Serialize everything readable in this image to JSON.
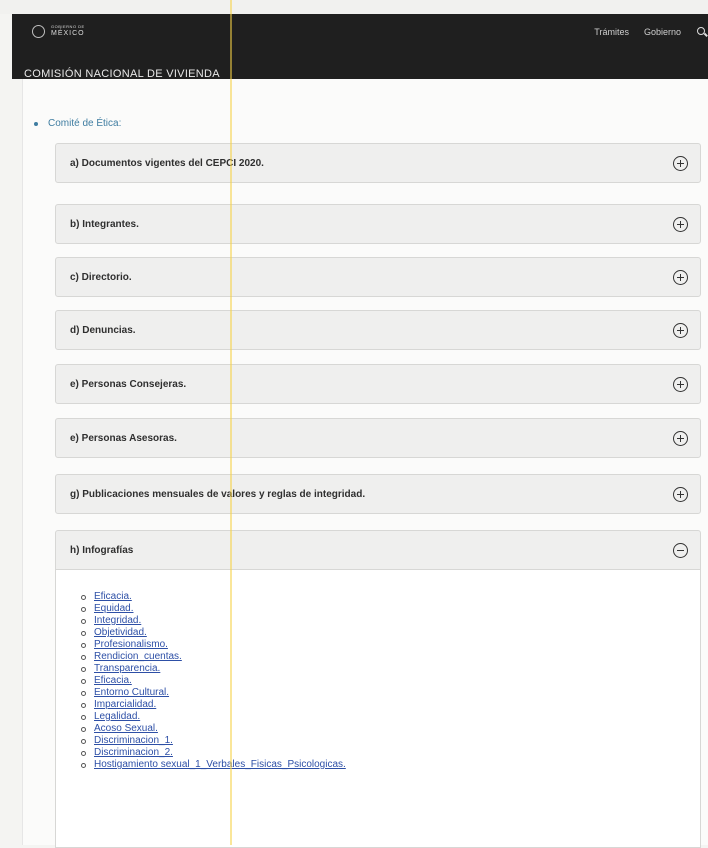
{
  "header": {
    "logo": {
      "line1": "GOBIERNO DE",
      "line2": "MÉXICO"
    },
    "nav": [
      "Trámites",
      "Gobierno"
    ],
    "search_icon": "search-icon",
    "org_name": "COMISIÓN NACIONAL DE VIVIENDA"
  },
  "main": {
    "committee_label": "Comité de Ética:",
    "accordion": [
      {
        "title": "a) Documentos vigentes del CEPCI 2020.",
        "icon": "plus-circle-icon"
      },
      {
        "title": "b) Integrantes.",
        "icon": "plus-circle-icon"
      },
      {
        "title": "c) Directorio.",
        "icon": "plus-circle-icon"
      },
      {
        "title": "d) Denuncias.",
        "icon": "plus-circle-icon"
      },
      {
        "title": "e) Personas Consejeras.",
        "icon": "plus-circle-icon"
      },
      {
        "title": "e) Personas Asesoras.",
        "icon": "plus-circle-icon"
      },
      {
        "title": "g) Publicaciones mensuales de valores y reglas de integridad.",
        "icon": "plus-circle-icon"
      },
      {
        "title": "h) Infografías",
        "icon": "minus-circle-icon"
      }
    ],
    "infografias": [
      "Eficacia.",
      "Equidad.",
      "Integridad.",
      "Objetividad.",
      "Profesionalismo.",
      "Rendicion_cuentas.",
      "Transparencia.",
      "Eficacia.",
      "Entorno Cultural.",
      "Imparcialidad.",
      "Legalidad.",
      "Acoso Sexual.",
      "Discriminacion_1.",
      "Discriminacion_2.",
      "Hostigamiento sexual_1_Verbales_Fisicas_Psicologicas."
    ]
  },
  "colors": {
    "header_bg": "#1f1f1f",
    "link": "#2d4fa6",
    "committee_link": "#3f7da1"
  }
}
